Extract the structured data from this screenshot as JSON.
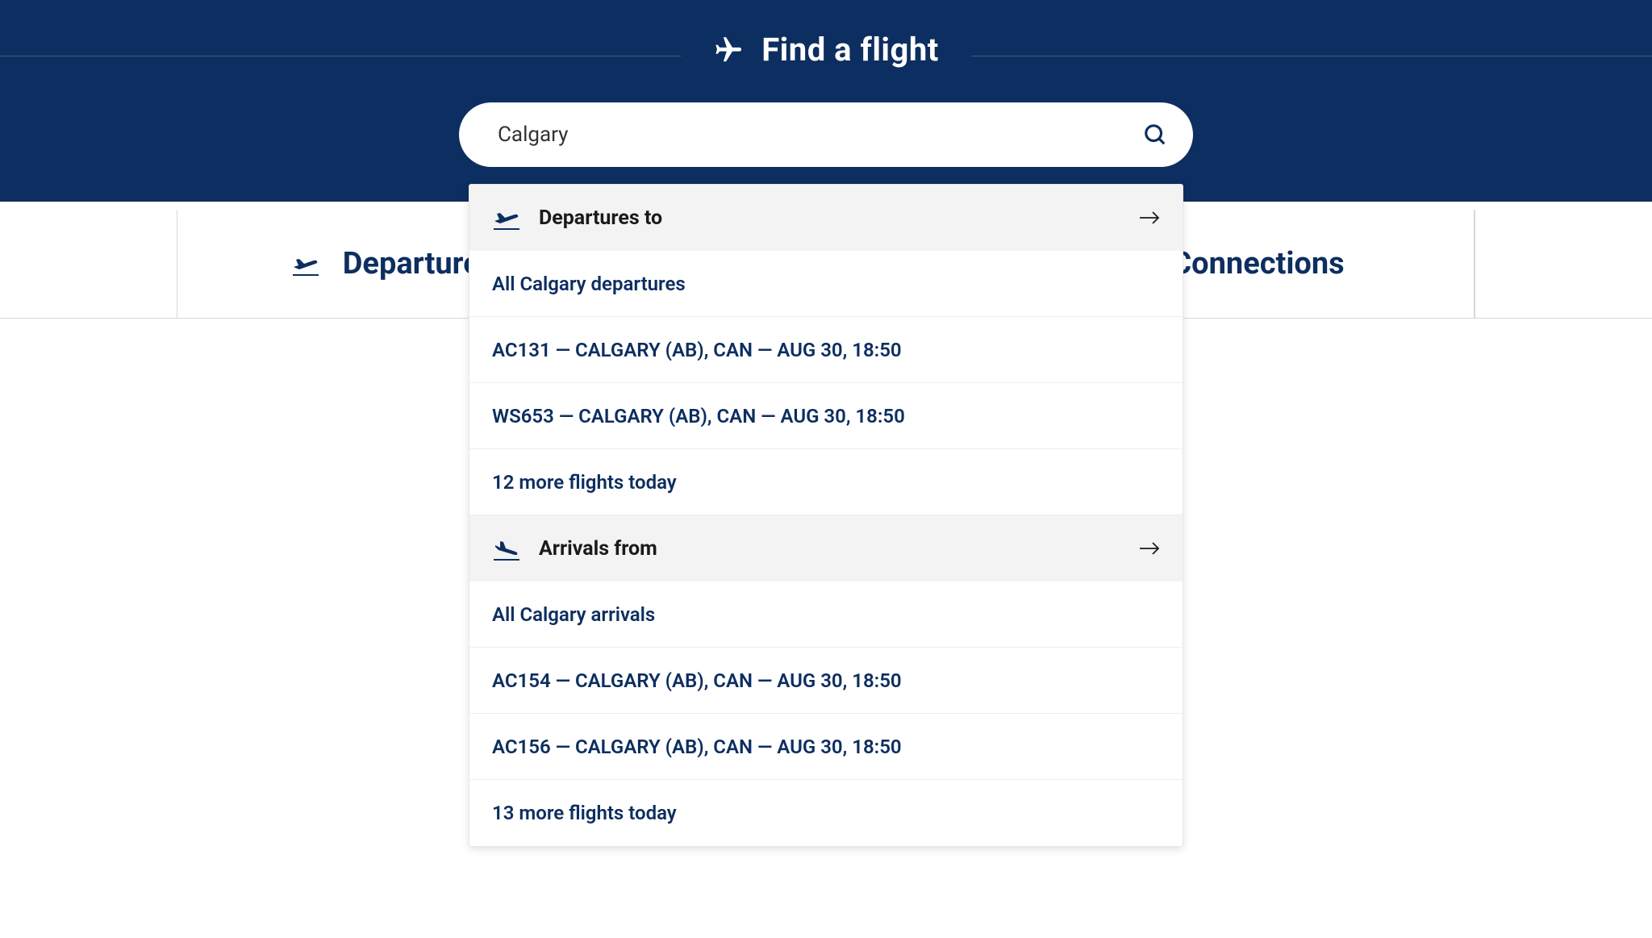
{
  "header": {
    "title": "Find a flight"
  },
  "search": {
    "value": "Calgary"
  },
  "tabs": {
    "departures": "Departures",
    "connections": "Connections"
  },
  "dropdown": {
    "departures": {
      "header": "Departures to",
      "allLink": "All Calgary departures",
      "flights": [
        "AC131 — CALGARY (AB), CAN — AUG 30, 18:50",
        "WS653 — CALGARY (AB), CAN — AUG 30, 18:50"
      ],
      "more": "12 more flights today"
    },
    "arrivals": {
      "header": "Arrivals from",
      "allLink": "All Calgary arrivals",
      "flights": [
        "AC154 — CALGARY (AB), CAN — AUG 30, 18:50",
        "AC156 — CALGARY (AB), CAN — AUG 30, 18:50"
      ],
      "more": "13 more flights today"
    }
  }
}
